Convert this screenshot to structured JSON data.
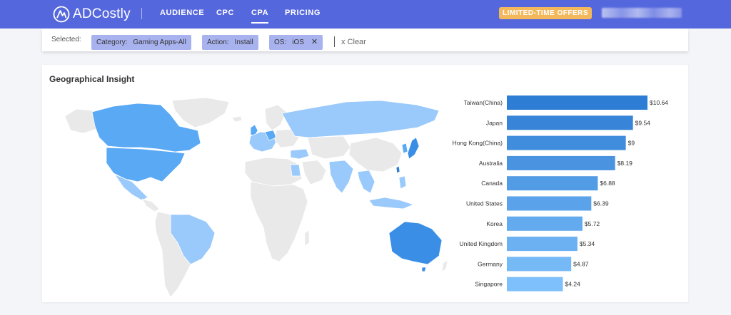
{
  "app": {
    "logo_text": "ADCostly"
  },
  "nav": {
    "items": [
      {
        "label": "AUDIENCE",
        "active": false
      },
      {
        "label": "CPC",
        "active": false
      },
      {
        "label": "CPA",
        "active": true
      },
      {
        "label": "PRICING",
        "active": false
      }
    ],
    "offer_label": "LIMITED-TIME OFFERS"
  },
  "filters": {
    "label": "Selected:",
    "chips": [
      {
        "key": "Category:",
        "value": "Gaming Apps-All"
      },
      {
        "key": "Action:",
        "value": "Install"
      },
      {
        "key": "OS:",
        "value": "iOS",
        "close": "✕"
      }
    ],
    "clear_label": "x Clear"
  },
  "geo": {
    "title": "Geographical Insight"
  },
  "colors": {
    "nav_bg": "#5567dd",
    "offer": "#f4b85c",
    "chip": "#a8b2ee",
    "map_base": "#e9e9e9",
    "map_high": "#3a8ee6",
    "map_mid": "#5aa9f5",
    "map_low": "#9ac9fb"
  },
  "chart_data": {
    "type": "bar",
    "orientation": "horizontal",
    "categories": [
      "Taiwan(China)",
      "Japan",
      "Hong Kong(China)",
      "Australia",
      "Canada",
      "United States",
      "Korea",
      "United Kingdom",
      "Germany",
      "Singapore"
    ],
    "values": [
      10.64,
      9.54,
      9,
      8.19,
      6.88,
      6.39,
      5.72,
      5.34,
      4.87,
      4.24
    ],
    "value_labels": [
      "$10.64",
      "$9.54",
      "$9",
      "$8.19",
      "$6.88",
      "$6.39",
      "$5.72",
      "$5.34",
      "$4.87",
      "$4.24"
    ],
    "xlim": [
      0,
      10.64
    ],
    "grid": false
  }
}
